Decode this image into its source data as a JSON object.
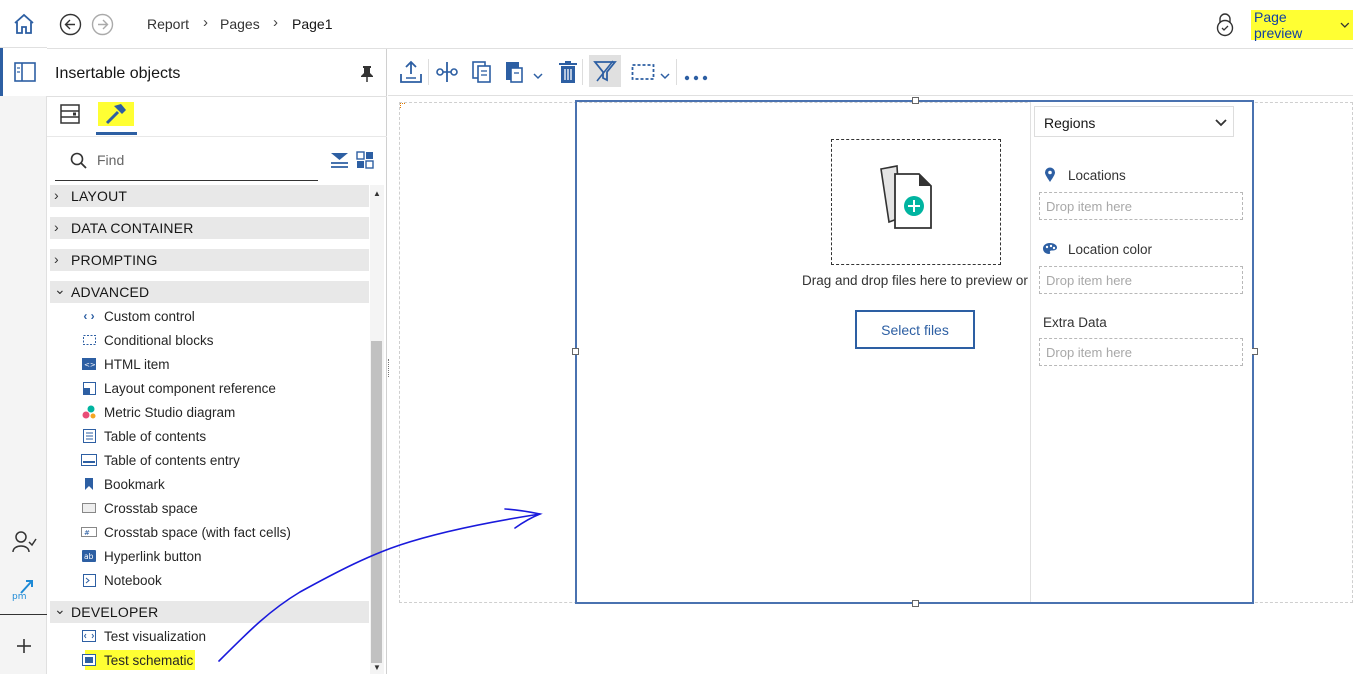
{
  "breadcrumb": [
    "Report",
    "Pages",
    "Page1"
  ],
  "page_preview_label": "Page preview",
  "panel": {
    "title": "Insertable objects",
    "find_placeholder": "Find",
    "sections": [
      {
        "label": "LAYOUT",
        "expanded": false
      },
      {
        "label": "DATA CONTAINER",
        "expanded": false
      },
      {
        "label": "PROMPTING",
        "expanded": false
      },
      {
        "label": "ADVANCED",
        "expanded": true
      },
      {
        "label": "DEVELOPER",
        "expanded": true
      }
    ],
    "advanced_items": [
      {
        "label": "Custom control",
        "icon": "code-icon"
      },
      {
        "label": "Conditional blocks",
        "icon": "dashed-box-icon"
      },
      {
        "label": "HTML item",
        "icon": "html-icon"
      },
      {
        "label": "Layout component reference",
        "icon": "layout-reference-icon"
      },
      {
        "label": "Metric Studio diagram",
        "icon": "metric-diagram-icon"
      },
      {
        "label": "Table of contents",
        "icon": "toc-icon"
      },
      {
        "label": "Table of contents entry",
        "icon": "toc-entry-icon"
      },
      {
        "label": "Bookmark",
        "icon": "bookmark-icon"
      },
      {
        "label": "Crosstab space",
        "icon": "crosstab-space-icon"
      },
      {
        "label": "Crosstab space (with fact cells)",
        "icon": "crosstab-fact-icon"
      },
      {
        "label": "Hyperlink button",
        "icon": "hyperlink-button-icon"
      },
      {
        "label": "Notebook",
        "icon": "notebook-icon"
      }
    ],
    "developer_items": [
      {
        "label": "Test visualization",
        "icon": "visualization-icon"
      },
      {
        "label": "Test schematic",
        "icon": "schematic-icon",
        "highlighted": true
      }
    ]
  },
  "canvas": {
    "drop_text": "Drag and drop files here to preview or",
    "select_files_label": "Select files",
    "regions_select": "Regions",
    "locations_label": "Locations",
    "location_color_label": "Location color",
    "extra_data_label": "Extra Data",
    "drop_item_placeholder": "Drop item here"
  },
  "colors": {
    "accent_blue": "#0f62fe",
    "highlight_yellow": "#ffff33",
    "frame_blue": "#4a72b0",
    "annotation_ink": "#1a1adc",
    "teal": "#00b4a0"
  }
}
